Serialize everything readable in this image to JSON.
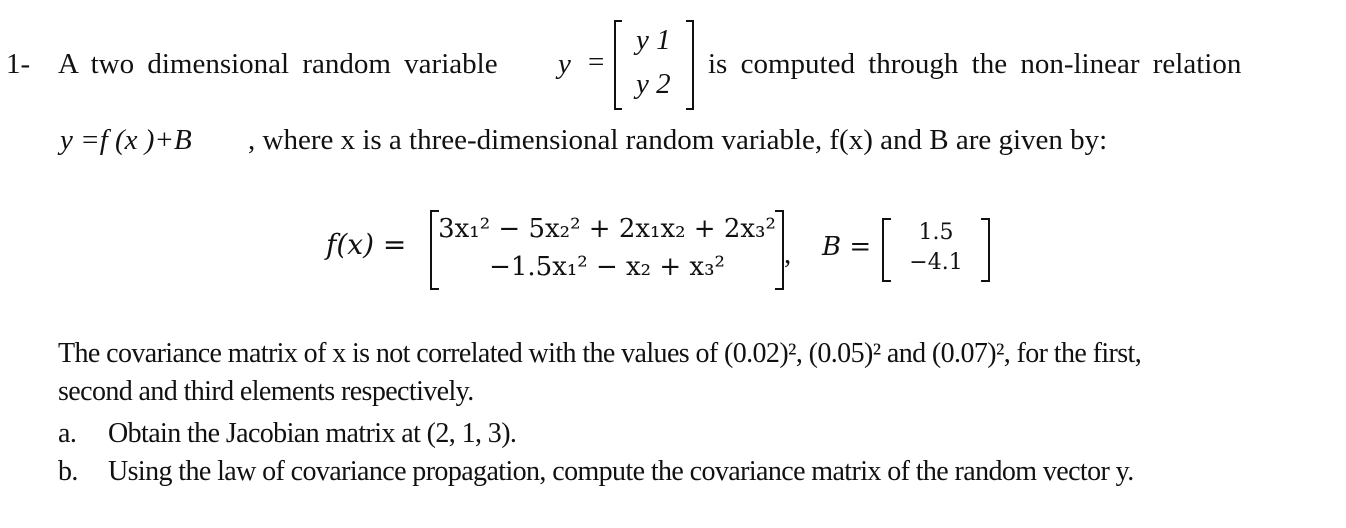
{
  "problem": {
    "number": "1-",
    "intro_text": "A two dimensional random variable",
    "y_symbol": "y",
    "equals": "=",
    "y_vector": [
      "y 1",
      "y 2"
    ],
    "intro_cont": "is computed through the non-linear relation",
    "relation_formula": "y =f (x )+B",
    "relation_desc": ", where x is a three-dimensional random variable, f(x) and B are given by:",
    "fx_label": "f(x) =",
    "fx_rows": [
      "3x₁² − 5x₂² + 2x₁x₂ + 2x₃²",
      "−1.5x₁² − x₂ + x₃²"
    ],
    "fx_comma": ",",
    "b_label": "B =",
    "b_values": [
      "1.5",
      "−4.1"
    ],
    "covariance_line1": "The covariance matrix of x is not correlated with the values of (0.02)², (0.05)² and (0.07)², for the first,",
    "covariance_line2": "second and third elements respectively.",
    "items": [
      {
        "label": "a.",
        "text": "Obtain the Jacobian matrix at (2, 1, 3)."
      },
      {
        "label": "b.",
        "text": "Using the law of covariance propagation, compute the covariance matrix of the random vector y."
      }
    ]
  }
}
